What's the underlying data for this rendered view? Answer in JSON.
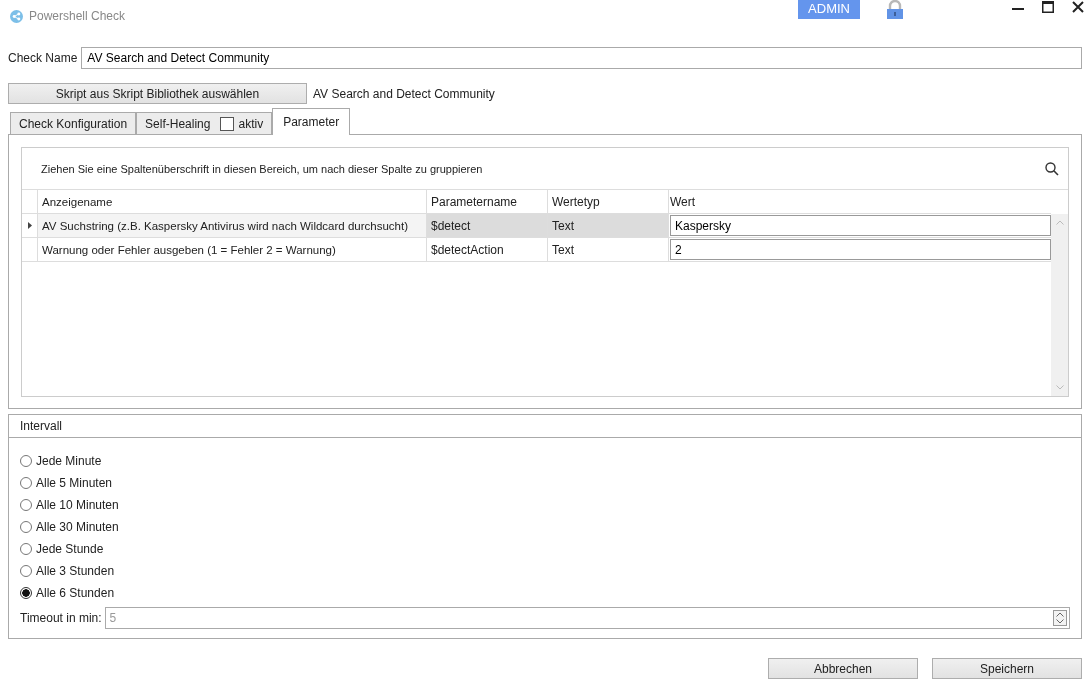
{
  "window": {
    "title": "Powershell Check",
    "user_badge": "ADMIN"
  },
  "check_name": {
    "label": "Check Name",
    "value": "AV Search and Detect Community"
  },
  "script": {
    "button": "Skript aus Skript Bibliothek auswählen",
    "name": "AV Search and Detect Community"
  },
  "tabs": [
    {
      "label": "Check Konfiguration",
      "selected": false
    },
    {
      "label": "Self-Healing",
      "selected": false,
      "checkbox": {
        "label": "aktiv",
        "checked": false
      }
    },
    {
      "label": "Parameter",
      "selected": true
    }
  ],
  "grid": {
    "group_hint": "Ziehen Sie eine Spaltenüberschrift in diesen Bereich, um nach dieser Spalte zu gruppieren",
    "columns": [
      "Anzeigename",
      "Parametername",
      "Wertetyp",
      "Wert"
    ],
    "rows": [
      {
        "selected": true,
        "cells": [
          "AV Suchstring (z.B. Kaspersky Antivirus wird nach Wildcard durchsucht)",
          "$detect",
          "Text",
          "Kaspersky"
        ]
      },
      {
        "selected": false,
        "cells": [
          "Warnung oder Fehler ausgeben (1 = Fehler 2 = Warnung)",
          "$detectAction",
          "Text",
          "2"
        ]
      }
    ]
  },
  "interval": {
    "title": "Intervall",
    "options": [
      {
        "label": "Jede Minute",
        "selected": false
      },
      {
        "label": "Alle 5 Minuten",
        "selected": false
      },
      {
        "label": "Alle 10 Minuten",
        "selected": false
      },
      {
        "label": "Alle 30 Minuten",
        "selected": false
      },
      {
        "label": "Jede Stunde",
        "selected": false
      },
      {
        "label": "Alle 3 Stunden",
        "selected": false
      },
      {
        "label": "Alle 6 Stunden",
        "selected": true
      }
    ],
    "timeout": {
      "label": "Timeout in min:",
      "value": "5",
      "disabled": true
    }
  },
  "buttons": [
    "Abbrechen",
    "Speichern"
  ]
}
